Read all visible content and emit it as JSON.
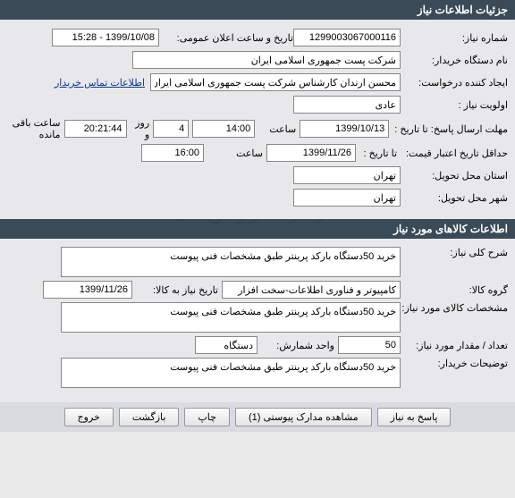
{
  "header": {
    "title": "جزئیات اطلاعات نیاز"
  },
  "labels": {
    "req_no": "شماره نیاز:",
    "announce_date": "تاریخ و ساعت اعلان عمومی:",
    "org_name": "نام دستگاه خریدار:",
    "requester": "ایجاد کننده درخواست:",
    "contact_link": "اطلاعات تماس خریدار",
    "priority": "اولویت نیاز :",
    "deadline": "مهلت ارسال پاسخ: تا تاریخ :",
    "time": "ساعت",
    "days": "روز و",
    "remaining": "ساعت باقی مانده",
    "min_date": "حداقل تاریخ اعتبار قیمت:",
    "to_date": "تا تاریخ :",
    "delivery_prov": "استان محل تحویل:",
    "delivery_city": "شهر محل تحویل:",
    "section2": "اطلاعات کالاهای مورد نیاز",
    "desc": "شرح کلی نیاز:",
    "group": "گروه کالا:",
    "group_date": "تاریخ نیاز به کالا:",
    "spec": "مشخصات کالای مورد نیاز:",
    "qty": "تعداد / مقدار مورد نیاز:",
    "unit": "واحد شمارش:",
    "buyer_notes": "توضیحات خریدار:"
  },
  "values": {
    "req_no": "1299003067000116",
    "announce_date": "1399/10/08 - 15:28",
    "org_name": "شرکت پست جمهوری اسلامی ایران",
    "requester": "محسن ارندان کارشناس شرکت پست جمهوری اسلامی ایران",
    "priority": "عادی",
    "deadline_date": "1399/10/13",
    "deadline_time": "14:00",
    "days": "4",
    "remaining": "20:21:44",
    "min_date": "1399/11/26",
    "min_time": "16:00",
    "delivery_prov": "تهران",
    "delivery_city": "تهران",
    "desc": "خرید 50دستگاه بارکد پرینتر طبق مشخصات فنی پیوست",
    "group": "کامپیوتر و فناوری اطلاعات-سخت افزار",
    "group_date": "1399/11/26",
    "spec": "خرید 50دستگاه بارکد پرینتر طبق مشخصات فنی پیوست",
    "qty": "50",
    "unit": "دستگاه",
    "buyer_notes": "خرید 50دستگاه بارکد پرینتر طبق مشخصات فنی پیوست"
  },
  "buttons": {
    "reply": "پاسخ به نیاز",
    "attachments": "مشاهده مدارک پیوستی (1)",
    "print": "چاپ",
    "back": "بازگشت",
    "exit": "خروج"
  },
  "watermark": {
    "line1": "مرکز آموزش ای استخدام",
    "line2": "۰۲۱-۸۸۲۴۹۶۷۰-۵"
  }
}
